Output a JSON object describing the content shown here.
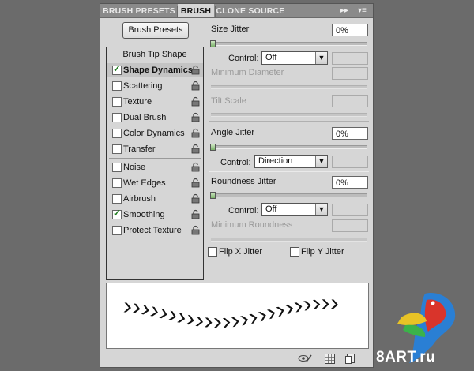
{
  "tabs": [
    {
      "label": "BRUSH PRESETS",
      "active": false
    },
    {
      "label": "BRUSH",
      "active": true
    },
    {
      "label": "CLONE SOURCE",
      "active": false
    }
  ],
  "toolbar": {
    "collapse_glyph": "▸▸",
    "menu_glyph": "▾≡"
  },
  "brush_presets_button": "Brush Presets",
  "list": {
    "title": "Brush Tip Shape",
    "items": [
      {
        "label": "Shape Dynamics",
        "checked": true,
        "selected": true
      },
      {
        "label": "Scattering",
        "checked": false
      },
      {
        "label": "Texture",
        "checked": false
      },
      {
        "label": "Dual Brush",
        "checked": false
      },
      {
        "label": "Color Dynamics",
        "checked": false
      },
      {
        "label": "Transfer",
        "checked": false
      },
      {
        "label": "Noise",
        "checked": false
      },
      {
        "label": "Wet Edges",
        "checked": false
      },
      {
        "label": "Airbrush",
        "checked": false
      },
      {
        "label": "Smoothing",
        "checked": true
      },
      {
        "label": "Protect Texture",
        "checked": false
      }
    ]
  },
  "settings": {
    "size_jitter": {
      "label": "Size Jitter",
      "value": "0%"
    },
    "control1": {
      "label": "Control:",
      "value": "Off"
    },
    "minimum_diameter": {
      "label": "Minimum Diameter"
    },
    "tilt_scale": {
      "label": "Tilt Scale"
    },
    "angle_jitter": {
      "label": "Angle Jitter",
      "value": "0%"
    },
    "control2": {
      "label": "Control:",
      "value": "Direction"
    },
    "roundness_jitter": {
      "label": "Roundness Jitter",
      "value": "0%"
    },
    "control3": {
      "label": "Control:",
      "value": "Off"
    },
    "minimum_roundness": {
      "label": "Minimum Roundness"
    },
    "flip_x": {
      "label": "Flip X Jitter",
      "checked": false
    },
    "flip_y": {
      "label": "Flip Y Jitter",
      "checked": false
    }
  },
  "watermark": {
    "text": "8ART.ru"
  },
  "colors": {
    "panel": "#d6d6d6",
    "tabbar": "#8a8a8a",
    "check": "#1a7a1a",
    "slider_thumb": "#7ab168"
  }
}
